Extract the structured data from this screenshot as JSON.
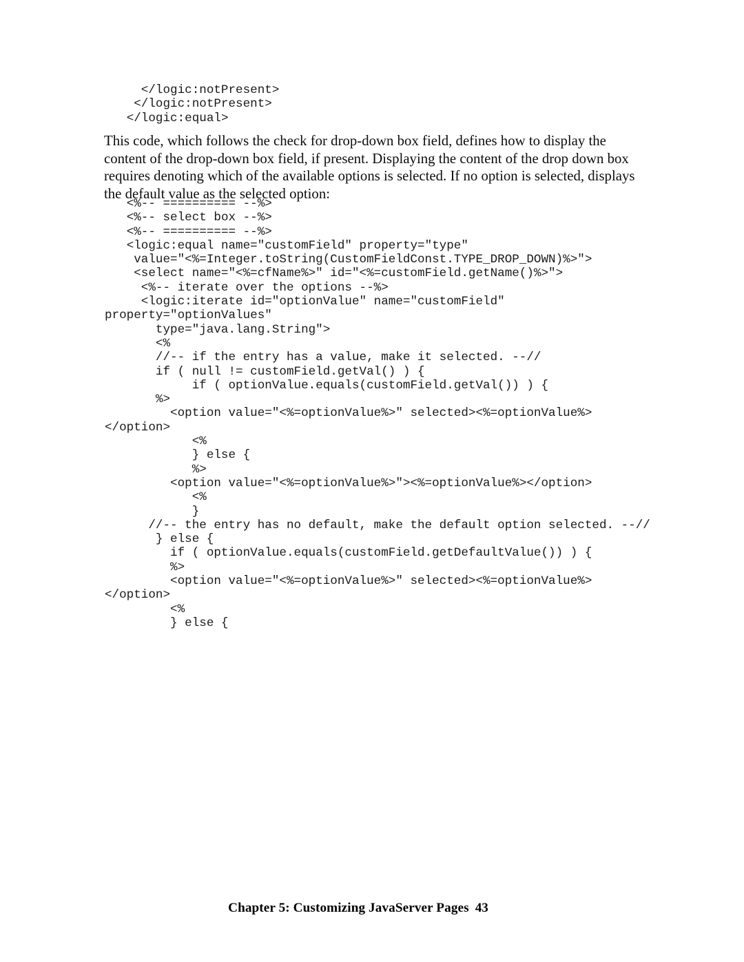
{
  "document": {
    "page_number": "43",
    "footer_title": "Chapter 5: Customizing JavaServer Pages",
    "background_color": "#ffffff",
    "text_color": "#0d0d0d"
  },
  "code_top": {
    "lines": [
      "     </logic:notPresent>",
      "    </logic:notPresent>",
      "   </logic:equal>"
    ]
  },
  "paragraph": {
    "text": "This code, which follows the check for drop-down box field, defines how to display the content of the drop-down box field, if present. Displaying the content of the drop down box requires denoting which of the available options is selected. If no option is selected, displays the default value as the selected option:"
  },
  "code_main": {
    "lines": [
      "   <%-- ========== --%>",
      "   <%-- select box --%>",
      "   <%-- ========== --%>",
      "   <logic:equal name=\"customField\" property=\"type\"",
      "    value=\"<%=Integer.toString(CustomFieldConst.TYPE_DROP_DOWN)%>\">",
      "    <select name=\"<%=cfName%>\" id=\"<%=customField.getName()%>\">",
      "     <%-- iterate over the options --%>",
      "     <logic:iterate id=\"optionValue\" name=\"customField\" property=\"optionValues\"",
      "       type=\"java.lang.String\">",
      "       <%",
      "       //-- if the entry has a value, make it selected. --//",
      "       if ( null != customField.getVal() ) {",
      "            if ( optionValue.equals(customField.getVal()) ) {",
      "       %>",
      "         <option value=\"<%=optionValue%>\" selected><%=optionValue%></option>",
      "            <%",
      "            } else {",
      "            %>",
      "         <option value=\"<%=optionValue%>\"><%=optionValue%></option>",
      "            <%",
      "            }",
      "      //-- the entry has no default, make the default option selected. --//",
      "       } else {",
      "         if ( optionValue.equals(customField.getDefaultValue()) ) {",
      "         %>",
      "         <option value=\"<%=optionValue%>\" selected><%=optionValue%></option>",
      "         <%",
      "         } else {"
    ]
  }
}
